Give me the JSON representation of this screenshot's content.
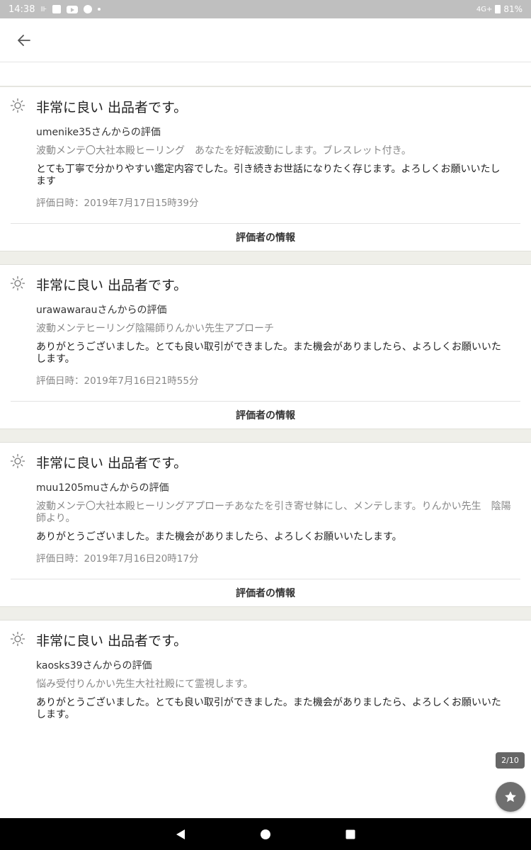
{
  "status_bar": {
    "time": "14:38",
    "notification_glyph": "⊪",
    "network": "4G+",
    "battery": "81%",
    "icons": [
      "sim-icon",
      "image-notification-icon",
      "youtube-icon",
      "app-icon",
      "more-dot-icon",
      "battery-icon"
    ]
  },
  "app_bar": {
    "back_icon": "arrow-left-icon"
  },
  "reviews": [
    {
      "rating": "非常に良い 出品者です。",
      "reviewer": "umenike35さんからの評価",
      "service": "波動メンテ〇大社本殿ヒーリング　あなたを好転波動にします。ブレスレット付き。",
      "comment": "とても丁寧で分かりやすい鑑定内容でした。引き続きお世話になりたく存じます。よろしくお願いいたします",
      "date": "評価日時：2019年7月17日15時39分",
      "info_label": "評価者の情報"
    },
    {
      "rating": "非常に良い 出品者です。",
      "reviewer": "urawawarauさんからの評価",
      "service": "波動メンテヒーリング陰陽師りんかい先生アプローチ",
      "comment": "ありがとうございました。とても良い取引ができました。また機会がありましたら、よろしくお願いいたします。",
      "date": "評価日時：2019年7月16日21時55分",
      "info_label": "評価者の情報"
    },
    {
      "rating": "非常に良い 出品者です。",
      "reviewer": "muu1205muさんからの評価",
      "service": "波動メンテ〇大社本殿ヒーリングアプローチあなたを引き寄せ躰にし、メンテします。りんかい先生　陰陽師より。",
      "comment": "ありがとうございました。また機会がありましたら、よろしくお願いいたします。",
      "date": "評価日時：2019年7月16日20時17分",
      "info_label": "評価者の情報"
    },
    {
      "rating": "非常に良い 出品者です。",
      "reviewer": "kaosks39さんからの評価",
      "service": "悩み受付りんかい先生大社社殿にて霊視します。",
      "comment": "ありがとうございました。とても良い取引ができました。また機会がありましたら、よろしくお願いいたします。"
    }
  ],
  "page_indicator": "2/10",
  "colors": {
    "status_bar": "#bfbfbf",
    "section_gap": "#efefe9",
    "muted_text": "#888888",
    "fab": "#6f6f6f"
  }
}
